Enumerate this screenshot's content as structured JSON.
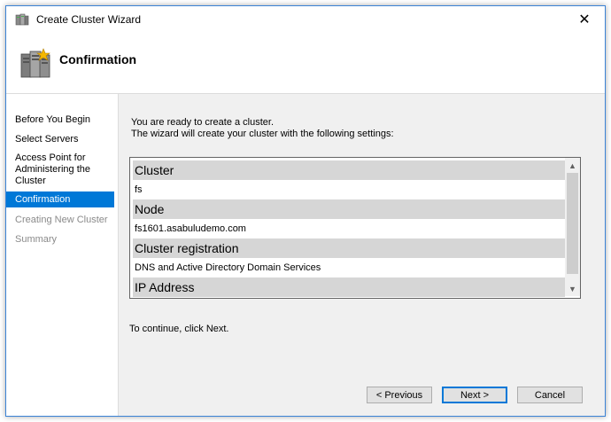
{
  "window": {
    "title": "Create Cluster Wizard",
    "close_glyph": "✕"
  },
  "header": {
    "title": "Confirmation",
    "icon": "cluster-servers-icon"
  },
  "nav": {
    "items": [
      {
        "label": "Before You Begin",
        "state": "normal"
      },
      {
        "label": "Select Servers",
        "state": "normal"
      },
      {
        "label": "Access Point for\nAdministering the\nCluster",
        "state": "normal"
      },
      {
        "label": "Confirmation",
        "state": "selected"
      },
      {
        "label": "Creating New Cluster",
        "state": "disabled"
      },
      {
        "label": "Summary",
        "state": "disabled"
      }
    ]
  },
  "content": {
    "intro_line1": "You are ready to create a cluster.",
    "intro_line2": "The wizard will create your cluster with the following settings:",
    "settings": [
      {
        "heading": "Cluster",
        "value": "fs"
      },
      {
        "heading": "Node",
        "value": "fs1601.asabuludemo.com"
      },
      {
        "heading": "Cluster registration",
        "value": "DNS and Active Directory Domain Services"
      },
      {
        "heading": "IP Address",
        "value": ""
      }
    ],
    "continue_text": "To continue, click Next."
  },
  "buttons": {
    "previous": "< Previous",
    "next": "Next >",
    "cancel": "Cancel"
  },
  "colors": {
    "selection": "#0078d7",
    "section_header_bg": "#d6d6d6",
    "window_border": "#3b83d6"
  }
}
